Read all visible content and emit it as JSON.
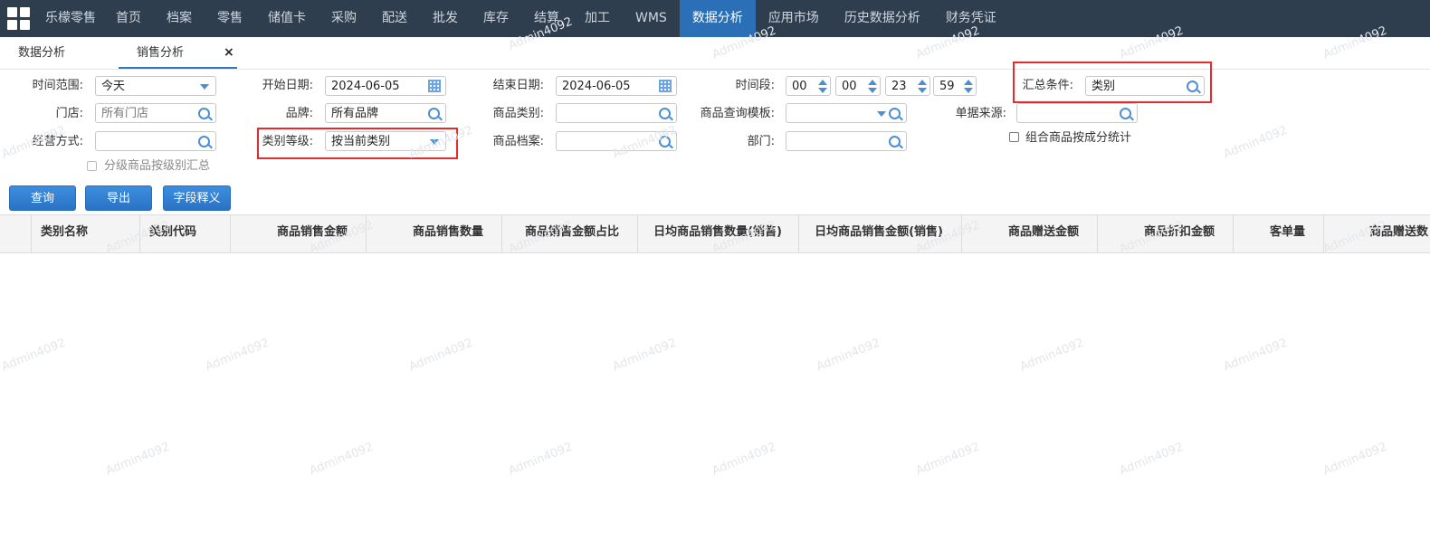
{
  "app": {
    "brand": "乐檬零售",
    "nav": [
      "首页",
      "档案",
      "零售",
      "储值卡",
      "采购",
      "配送",
      "批发",
      "库存",
      "结算",
      "加工",
      "WMS",
      "数据分析",
      "应用市场",
      "历史数据分析",
      "财务凭证"
    ]
  },
  "tabs": {
    "tab1": "数据分析",
    "tab2": "销售分析",
    "close": "×"
  },
  "form": {
    "time_range_label": "时间范围:",
    "time_range_value": "今天",
    "start_date_label": "开始日期:",
    "start_date_value": "2024-06-05",
    "end_date_label": "结束日期:",
    "end_date_value": "2024-06-05",
    "time_period_label": "时间段:",
    "time_h1": "00",
    "time_m1": "00",
    "time_h2": "23",
    "time_m2": "59",
    "summary_label": "汇总条件:",
    "summary_value": "类别",
    "store_label": "门店:",
    "store_value": "所有门店",
    "brand_label": "品牌:",
    "brand_value": "所有品牌",
    "category_label": "商品类别:",
    "template_label": "商品查询模板:",
    "source_label": "单据来源:",
    "mode_label": "经营方式:",
    "level_label": "类别等级:",
    "level_value": "按当前类别",
    "archive_label": "商品档案:",
    "dept_label": "部门:",
    "combo_label": "组合商品按成分统计",
    "grade_label": "分级商品按级别汇总"
  },
  "buttons": {
    "query": "查询",
    "export": "导出",
    "fields": "字段释义"
  },
  "grid": {
    "columns": [
      "类别名称",
      "类别代码",
      "商品销售金额",
      "商品销售数量",
      "商品销售金额占比",
      "日均商品销售数量(销售)",
      "日均商品销售金额(销售)",
      "商品赠送金额",
      "商品折扣金额",
      "客单量",
      "商品赠送数"
    ]
  },
  "watermark": "Admin4092",
  "colors": {
    "topbar": "#2f3e4e",
    "nav_active": "#2b6fb6",
    "highlight": "#e52b2b",
    "button": "#2a72c2"
  }
}
